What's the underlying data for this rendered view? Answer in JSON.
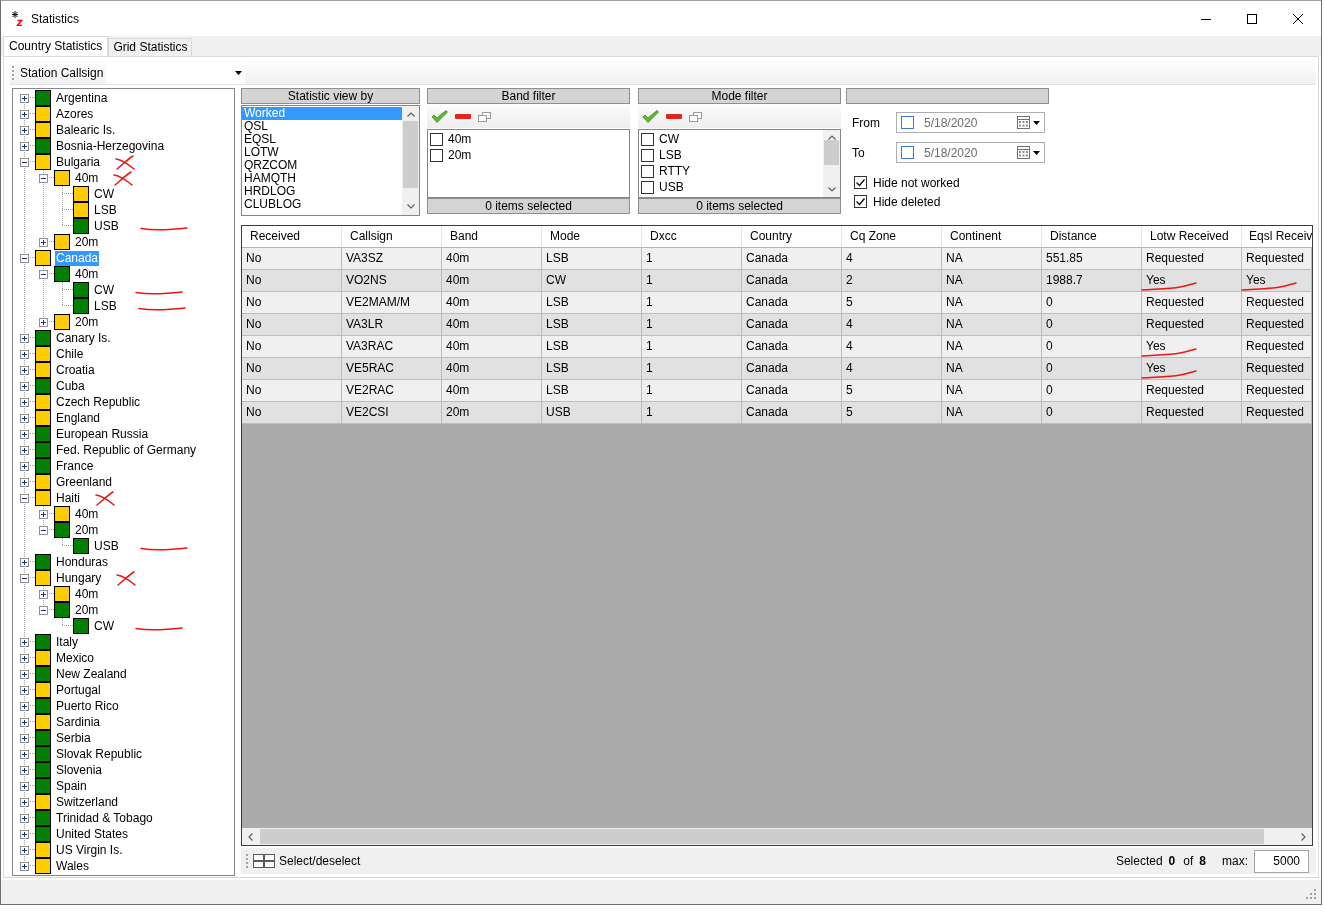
{
  "window": {
    "title": "Statistics"
  },
  "tabs": [
    {
      "label": "Country Statistics",
      "selected": true
    },
    {
      "label": "Grid Statistics",
      "selected": false
    }
  ],
  "toolbar": {
    "label": "Station Callsign"
  },
  "tree": [
    {
      "label": "Argentina",
      "color": "#008000",
      "expanded": false,
      "selected": false
    },
    {
      "label": "Azores",
      "color": "#ffcc00",
      "expanded": false,
      "selected": false
    },
    {
      "label": "Balearic Is.",
      "color": "#ffcc00",
      "expanded": false,
      "selected": false
    },
    {
      "label": "Bosnia-Herzegovina",
      "color": "#008000",
      "expanded": false,
      "selected": false
    },
    {
      "label": "Bulgaria",
      "color": "#ffcc00",
      "expanded": true,
      "selected": false,
      "crossed_out": true,
      "children": [
        {
          "label": "40m",
          "color": "#ffcc00",
          "expanded": true,
          "selected": false,
          "crossed_out": true,
          "children": [
            {
              "label": "CW",
              "color": "#ffcc00",
              "selected": false
            },
            {
              "label": "LSB",
              "color": "#ffcc00",
              "selected": false
            },
            {
              "label": "USB",
              "color": "#008000",
              "selected": false,
              "underlined": true
            }
          ]
        },
        {
          "label": "20m",
          "color": "#ffcc00",
          "expanded": false,
          "selected": false
        }
      ]
    },
    {
      "label": "Canada",
      "color": "#ffcc00",
      "expanded": true,
      "selected": true,
      "children": [
        {
          "label": "40m",
          "color": "#008000",
          "expanded": true,
          "selected": false,
          "children": [
            {
              "label": "CW",
              "color": "#008000",
              "selected": false,
              "underlined": true
            },
            {
              "label": "LSB",
              "color": "#008000",
              "selected": false,
              "underlined": true
            }
          ]
        },
        {
          "label": "20m",
          "color": "#ffcc00",
          "expanded": false,
          "selected": false
        }
      ]
    },
    {
      "label": "Canary Is.",
      "color": "#008000",
      "expanded": false,
      "selected": false
    },
    {
      "label": "Chile",
      "color": "#ffcc00",
      "expanded": false,
      "selected": false
    },
    {
      "label": "Croatia",
      "color": "#ffcc00",
      "expanded": false,
      "selected": false
    },
    {
      "label": "Cuba",
      "color": "#008000",
      "expanded": false,
      "selected": false
    },
    {
      "label": "Czech Republic",
      "color": "#ffcc00",
      "expanded": false,
      "selected": false
    },
    {
      "label": "England",
      "color": "#ffcc00",
      "expanded": false,
      "selected": false
    },
    {
      "label": "European Russia",
      "color": "#008000",
      "expanded": false,
      "selected": false
    },
    {
      "label": "Fed. Republic of Germany",
      "color": "#008000",
      "expanded": false,
      "selected": false
    },
    {
      "label": "France",
      "color": "#008000",
      "expanded": false,
      "selected": false
    },
    {
      "label": "Greenland",
      "color": "#ffcc00",
      "expanded": false,
      "selected": false
    },
    {
      "label": "Haiti",
      "color": "#ffcc00",
      "expanded": true,
      "selected": false,
      "crossed_out": true,
      "children": [
        {
          "label": "40m",
          "color": "#ffcc00",
          "expanded": false,
          "selected": false
        },
        {
          "label": "20m",
          "color": "#008000",
          "expanded": true,
          "selected": false,
          "children": [
            {
              "label": "USB",
              "color": "#008000",
              "selected": false,
              "underlined": true
            }
          ]
        }
      ]
    },
    {
      "label": "Honduras",
      "color": "#008000",
      "expanded": false,
      "selected": false
    },
    {
      "label": "Hungary",
      "color": "#ffcc00",
      "expanded": true,
      "selected": false,
      "crossed_out": true,
      "children": [
        {
          "label": "40m",
          "color": "#ffcc00",
          "expanded": false,
          "selected": false
        },
        {
          "label": "20m",
          "color": "#008000",
          "expanded": true,
          "selected": false,
          "children": [
            {
              "label": "CW",
              "color": "#008000",
              "selected": false,
              "underlined": true
            }
          ]
        }
      ]
    },
    {
      "label": "Italy",
      "color": "#008000",
      "expanded": false,
      "selected": false
    },
    {
      "label": "Mexico",
      "color": "#ffcc00",
      "expanded": false,
      "selected": false
    },
    {
      "label": "New Zealand",
      "color": "#008000",
      "expanded": false,
      "selected": false
    },
    {
      "label": "Portugal",
      "color": "#ffcc00",
      "expanded": false,
      "selected": false
    },
    {
      "label": "Puerto Rico",
      "color": "#008000",
      "expanded": false,
      "selected": false
    },
    {
      "label": "Sardinia",
      "color": "#ffcc00",
      "expanded": false,
      "selected": false
    },
    {
      "label": "Serbia",
      "color": "#008000",
      "expanded": false,
      "selected": false
    },
    {
      "label": "Slovak Republic",
      "color": "#008000",
      "expanded": false,
      "selected": false
    },
    {
      "label": "Slovenia",
      "color": "#008000",
      "expanded": false,
      "selected": false
    },
    {
      "label": "Spain",
      "color": "#008000",
      "expanded": false,
      "selected": false
    },
    {
      "label": "Switzerland",
      "color": "#ffcc00",
      "expanded": false,
      "selected": false
    },
    {
      "label": "Trinidad & Tobago",
      "color": "#008000",
      "expanded": false,
      "selected": false
    },
    {
      "label": "United States",
      "color": "#008000",
      "expanded": false,
      "selected": false
    },
    {
      "label": "US Virgin Is.",
      "color": "#ffcc00",
      "expanded": false,
      "selected": false
    },
    {
      "label": "Wales",
      "color": "#ffcc00",
      "expanded": false,
      "selected": false
    }
  ],
  "statistic_view": {
    "title": "Statistic view by",
    "items": [
      {
        "label": "Worked",
        "selected": true
      },
      {
        "label": "QSL",
        "selected": false
      },
      {
        "label": "EQSL",
        "selected": false
      },
      {
        "label": "LOTW",
        "selected": false
      },
      {
        "label": "QRZCOM",
        "selected": false
      },
      {
        "label": "HAMQTH",
        "selected": false
      },
      {
        "label": "HRDLOG",
        "selected": false
      },
      {
        "label": "CLUBLOG",
        "selected": false
      }
    ]
  },
  "band_filter": {
    "title": "Band filter",
    "items": [
      {
        "label": "40m",
        "checked": false
      },
      {
        "label": "20m",
        "checked": false
      }
    ],
    "footer": "0 items selected"
  },
  "mode_filter": {
    "title": "Mode filter",
    "items": [
      {
        "label": "CW",
        "checked": false
      },
      {
        "label": "LSB",
        "checked": false
      },
      {
        "label": "RTTY",
        "checked": false
      },
      {
        "label": "USB",
        "checked": false
      }
    ],
    "footer": "0 items selected"
  },
  "date_filter": {
    "fields": [
      {
        "label": "From",
        "checked": false,
        "value": "5/18/2020"
      },
      {
        "label": "To",
        "checked": false,
        "value": "5/18/2020"
      }
    ],
    "options": [
      {
        "label": "Hide not worked",
        "checked": true
      },
      {
        "label": "Hide deleted",
        "checked": true
      }
    ]
  },
  "table": {
    "columns": [
      "Received",
      "Callsign",
      "Band",
      "Mode",
      "Dxcc",
      "Country",
      "Cq Zone",
      "Continent",
      "Distance",
      "Lotw Received",
      "Eqsl Receiv"
    ],
    "rows": [
      [
        "No",
        "VA3SZ",
        "40m",
        "LSB",
        "1",
        "Canada",
        "4",
        "NA",
        "551.85",
        "Requested",
        "Requested"
      ],
      [
        "No",
        "VO2NS",
        "40m",
        "CW",
        "1",
        "Canada",
        "2",
        "NA",
        "1988.7",
        {
          "text": "Yes",
          "underlined": true
        },
        {
          "text": "Yes",
          "underlined": true
        }
      ],
      [
        "No",
        "VE2MAM/M",
        "40m",
        "LSB",
        "1",
        "Canada",
        "5",
        "NA",
        "0",
        "Requested",
        "Requested"
      ],
      [
        "No",
        "VA3LR",
        "40m",
        "LSB",
        "1",
        "Canada",
        "4",
        "NA",
        "0",
        "Requested",
        "Requested"
      ],
      [
        "No",
        "VA3RAC",
        "40m",
        "LSB",
        "1",
        "Canada",
        "4",
        "NA",
        "0",
        {
          "text": "Yes",
          "underlined": true
        },
        "Requested"
      ],
      [
        "No",
        "VE5RAC",
        "40m",
        "LSB",
        "1",
        "Canada",
        "4",
        "NA",
        "0",
        {
          "text": "Yes",
          "underlined": true
        },
        "Requested"
      ],
      [
        "No",
        "VE2RAC",
        "40m",
        "LSB",
        "1",
        "Canada",
        "5",
        "NA",
        "0",
        "Requested",
        "Requested"
      ],
      [
        "No",
        "VE2CSI",
        "20m",
        "USB",
        "1",
        "Canada",
        "5",
        "NA",
        "0",
        "Requested",
        "Requested"
      ]
    ]
  },
  "footer": {
    "button": "Select/deselect",
    "selected_label": "Selected",
    "selected_count": "0",
    "of_label": "of",
    "total": "8",
    "max_label": "max:",
    "max_value": "5000"
  }
}
